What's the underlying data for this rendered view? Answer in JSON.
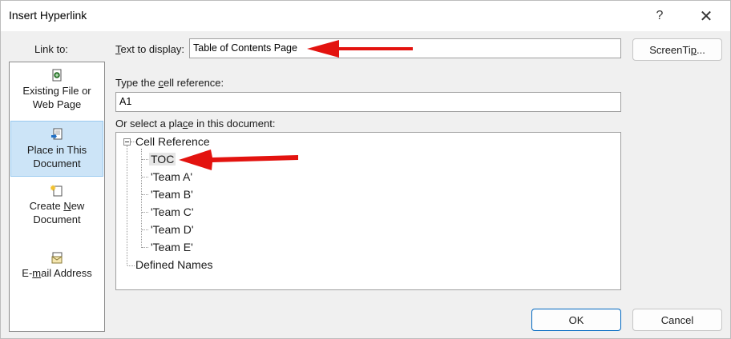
{
  "window": {
    "title": "Insert Hyperlink",
    "help_glyph": "?",
    "close_glyph": "✕"
  },
  "link_to": {
    "label": "Link to:",
    "items": [
      {
        "line1": "Existing File or",
        "line2": "Web Page",
        "icon": "existing-file-icon"
      },
      {
        "line1": "Place in This",
        "line2": "Document",
        "icon": "place-in-document-icon",
        "selected": true
      },
      {
        "line1": "Create New",
        "line2": "Document",
        "icon": "new-document-icon"
      },
      {
        "line1": "E-mail Address",
        "line2": "",
        "icon": "email-icon"
      }
    ]
  },
  "form": {
    "text_to_display_label": "Text to display:",
    "text_to_display_value": "Table of Contents Page",
    "screentip_label": "ScreenTip...",
    "cell_reference_label": "Type the cell reference:",
    "cell_reference_value": "A1",
    "place_label": "Or select a place in this document:"
  },
  "tree": {
    "root": "Cell Reference",
    "children": [
      "TOC",
      "'Team A'",
      "'Team B'",
      "'Team C'",
      "'Team D'",
      "'Team E'"
    ],
    "selected_child": "TOC",
    "second_root": "Defined Names"
  },
  "buttons": {
    "ok": "OK",
    "cancel": "Cancel"
  },
  "colors": {
    "selection_bg": "#cce4f7",
    "annotation_arrow": "#e3130f",
    "default_button_border": "#0067c0"
  }
}
